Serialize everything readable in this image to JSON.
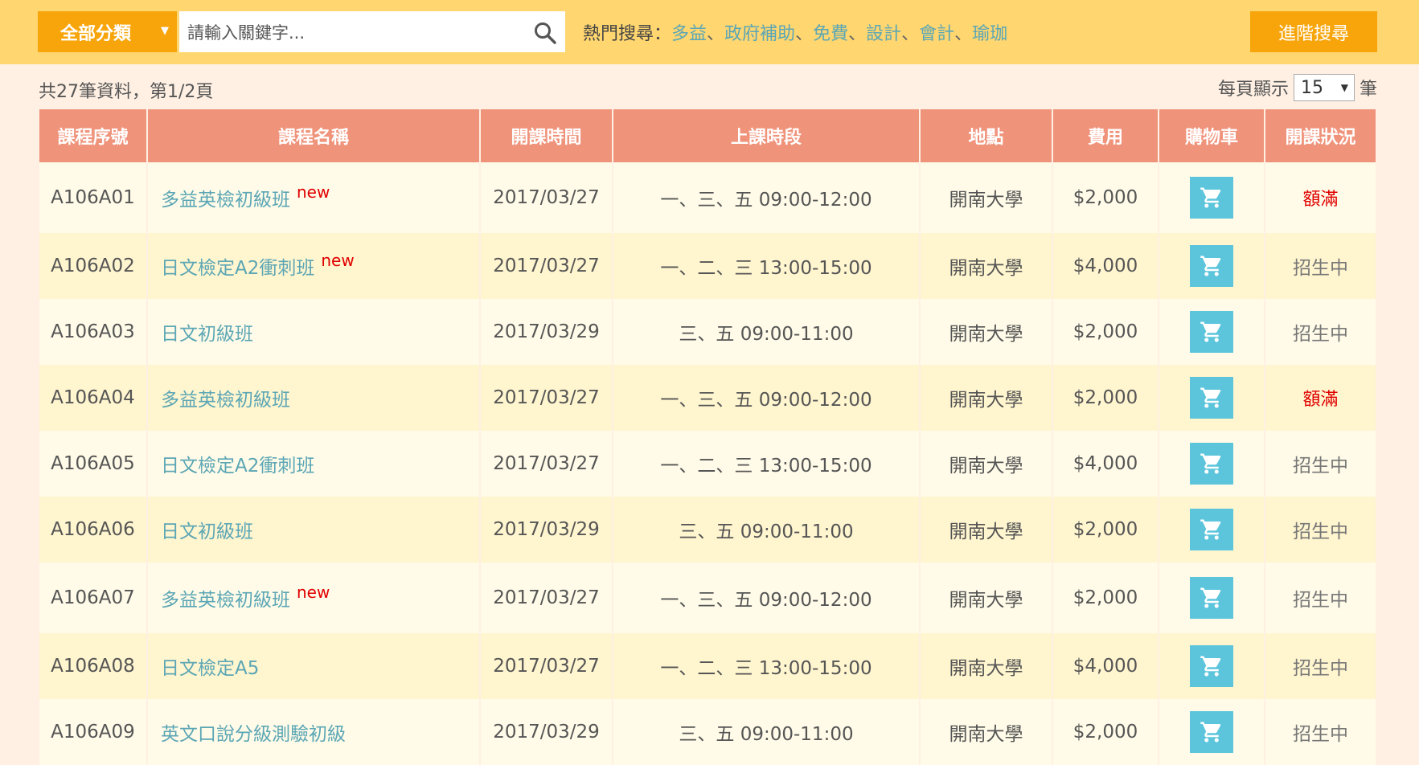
{
  "header": {
    "category_label": "全部分類",
    "search_placeholder": "請輸入關鍵字...",
    "hot_label": "熱門搜尋：",
    "hot_keywords": [
      "多益",
      "政府補助",
      "免費",
      "設計",
      "會計",
      "瑜珈"
    ],
    "hot_separator": "、",
    "advanced_search_label": "進階搜尋"
  },
  "summary": {
    "text": "共27筆資料，第1/2頁",
    "per_page_prefix": "每頁顯示",
    "per_page_value": "15",
    "per_page_suffix": "筆"
  },
  "table": {
    "headers": [
      "課程序號",
      "課程名稱",
      "開課時間",
      "上課時段",
      "地點",
      "費用",
      "購物車",
      "開課狀況"
    ],
    "rows": [
      {
        "id": "A106A01",
        "name": "多益英檢初級班",
        "new": "new",
        "date": "2017/03/27",
        "time": "一、三、五 09:00-12:00",
        "place": "開南大學",
        "fee": "$2,000",
        "status": "額滿"
      },
      {
        "id": "A106A02",
        "name": "日文檢定A2衝刺班",
        "new": "new",
        "date": "2017/03/27",
        "time": "一、二、三 13:00-15:00",
        "place": "開南大學",
        "fee": "$4,000",
        "status": "招生中"
      },
      {
        "id": "A106A03",
        "name": "日文初級班",
        "new": "",
        "date": "2017/03/29",
        "time": "三、五 09:00-11:00",
        "place": "開南大學",
        "fee": "$2,000",
        "status": "招生中"
      },
      {
        "id": "A106A04",
        "name": "多益英檢初級班",
        "new": "",
        "date": "2017/03/27",
        "time": "一、三、五 09:00-12:00",
        "place": "開南大學",
        "fee": "$2,000",
        "status": "額滿"
      },
      {
        "id": "A106A05",
        "name": "日文檢定A2衝刺班",
        "new": "",
        "date": "2017/03/27",
        "time": "一、二、三 13:00-15:00",
        "place": "開南大學",
        "fee": "$4,000",
        "status": "招生中"
      },
      {
        "id": "A106A06",
        "name": "日文初級班",
        "new": "",
        "date": "2017/03/29",
        "time": "三、五 09:00-11:00",
        "place": "開南大學",
        "fee": "$2,000",
        "status": "招生中"
      },
      {
        "id": "A106A07",
        "name": "多益英檢初級班",
        "new": "new",
        "date": "2017/03/27",
        "time": "一、三、五 09:00-12:00",
        "place": "開南大學",
        "fee": "$2,000",
        "status": "招生中"
      },
      {
        "id": "A106A08",
        "name": "日文檢定A5",
        "new": "",
        "date": "2017/03/27",
        "time": "一、二、三 13:00-15:00",
        "place": "開南大學",
        "fee": "$4,000",
        "status": "招生中"
      },
      {
        "id": "A106A09",
        "name": "英文口說分級測驗初級",
        "new": "",
        "date": "2017/03/29",
        "time": "三、五 09:00-11:00",
        "place": "開南大學",
        "fee": "$2,000",
        "status": "招生中"
      }
    ]
  },
  "colors": {
    "topbar": "#ffd66f",
    "accent_orange": "#f7a50a",
    "table_header": "#f0937b",
    "link": "#5ba6b5",
    "full_status": "#e00000",
    "cart_button": "#5cc5dc"
  },
  "icons": {
    "search": "search-icon",
    "cart": "shopping-cart-icon",
    "dropdown": "chevron-down-icon"
  }
}
